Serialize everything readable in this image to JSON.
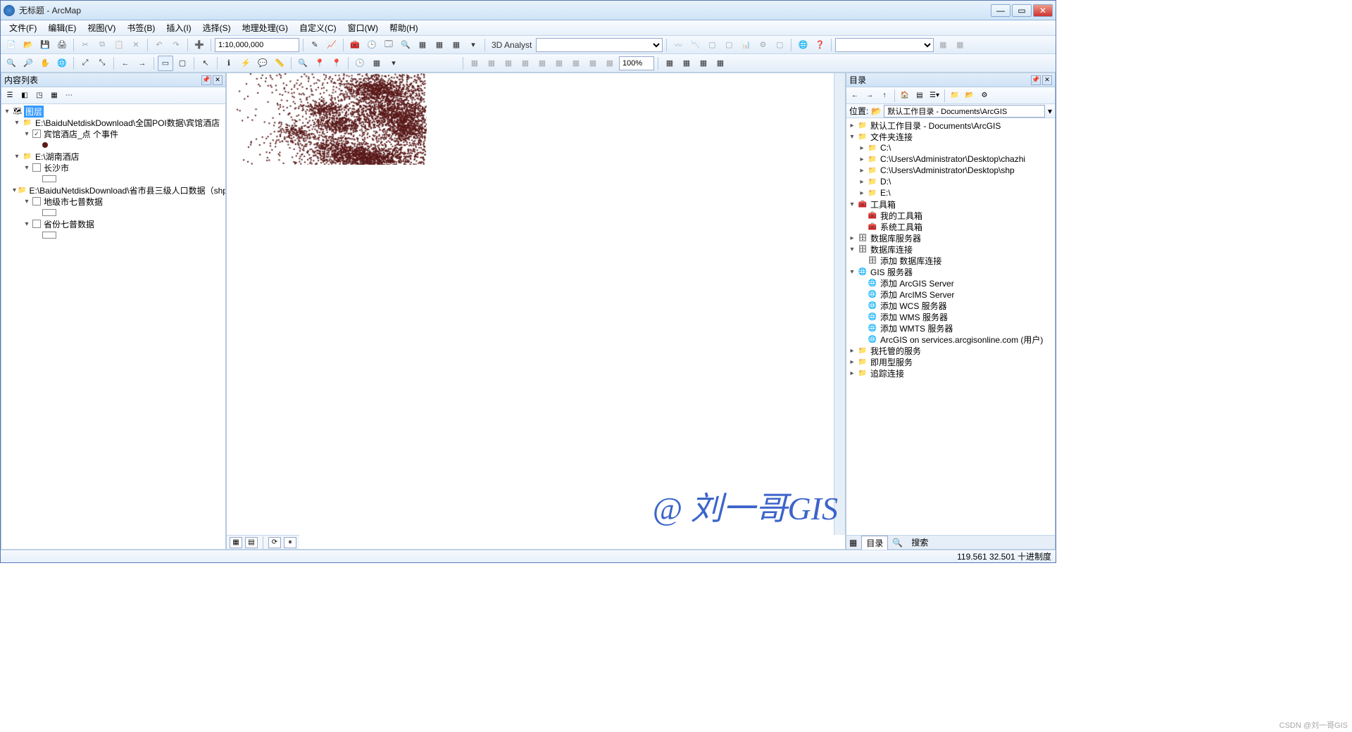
{
  "window": {
    "title": "无标题 - ArcMap"
  },
  "menu": [
    "文件(F)",
    "编辑(E)",
    "视图(V)",
    "书签(B)",
    "插入(I)",
    "选择(S)",
    "地理处理(G)",
    "自定义(C)",
    "窗口(W)",
    "帮助(H)"
  ],
  "toolbar1": {
    "scale": "1:10,000,000",
    "analyst_label": "3D Analyst"
  },
  "toolbar2": {
    "zoom": "100%"
  },
  "toc": {
    "title": "内容列表",
    "root": "图层",
    "groups": [
      {
        "path": "E:\\BaiduNetdiskDownload\\全国POI数据\\宾馆酒店",
        "layers": [
          {
            "name": "宾馆酒店_点 个事件",
            "checked": true,
            "sym": "dot"
          }
        ]
      },
      {
        "path": "E:\\湖南酒店",
        "layers": [
          {
            "name": "长沙市",
            "checked": false,
            "sym": "swatch",
            "color": "#ffffff"
          }
        ]
      },
      {
        "path": "E:\\BaiduNetdiskDownload\\省市县三级人口数据（shp格式）",
        "layers": [
          {
            "name": "地级市七普数据",
            "checked": false,
            "sym": "swatch",
            "color": "#ffffff"
          },
          {
            "name": "省份七普数据",
            "checked": false,
            "sym": "swatch",
            "color": "#ffffff"
          }
        ]
      }
    ]
  },
  "catalog": {
    "title": "目录",
    "loc_label": "位置:",
    "loc_value": "默认工作目录 - Documents\\ArcGIS",
    "tree": [
      {
        "icon": "folder",
        "label": "默认工作目录 - Documents\\ArcGIS",
        "t": "+"
      },
      {
        "icon": "folder",
        "label": "文件夹连接",
        "t": "-",
        "children": [
          {
            "icon": "folder",
            "label": "C:\\",
            "t": "+"
          },
          {
            "icon": "folder",
            "label": "C:\\Users\\Administrator\\Desktop\\chazhi",
            "t": "+"
          },
          {
            "icon": "folder",
            "label": "C:\\Users\\Administrator\\Desktop\\shp",
            "t": "+"
          },
          {
            "icon": "folder",
            "label": "D:\\",
            "t": "+"
          },
          {
            "icon": "folder",
            "label": "E:\\",
            "t": "+"
          }
        ]
      },
      {
        "icon": "toolbox",
        "label": "工具箱",
        "t": "-",
        "children": [
          {
            "icon": "toolbox",
            "label": "我的工具箱"
          },
          {
            "icon": "toolbox",
            "label": "系统工具箱"
          }
        ]
      },
      {
        "icon": "db",
        "label": "数据库服务器",
        "t": "+"
      },
      {
        "icon": "db",
        "label": "数据库连接",
        "t": "-",
        "children": [
          {
            "icon": "db",
            "label": "添加 数据库连接"
          }
        ]
      },
      {
        "icon": "globe",
        "label": "GIS 服务器",
        "t": "-",
        "children": [
          {
            "icon": "globe",
            "label": "添加 ArcGIS Server"
          },
          {
            "icon": "globe",
            "label": "添加 ArcIMS Server"
          },
          {
            "icon": "globe",
            "label": "添加 WCS 服务器"
          },
          {
            "icon": "globe",
            "label": "添加 WMS 服务器"
          },
          {
            "icon": "globe",
            "label": "添加 WMTS 服务器"
          },
          {
            "icon": "globe",
            "label": "ArcGIS on services.arcgisonline.com (用户)"
          }
        ]
      },
      {
        "icon": "folder",
        "label": "我托管的服务",
        "t": "+"
      },
      {
        "icon": "folder",
        "label": "即用型服务",
        "t": "+"
      },
      {
        "icon": "folder",
        "label": "追踪连接",
        "t": "+"
      }
    ],
    "tabs": [
      "目录",
      "搜索"
    ]
  },
  "status": {
    "coords": "119.561 32.501 十进制度"
  },
  "watermark": "@ 刘一哥GIS",
  "csdn": "CSDN @刘一哥GIS"
}
